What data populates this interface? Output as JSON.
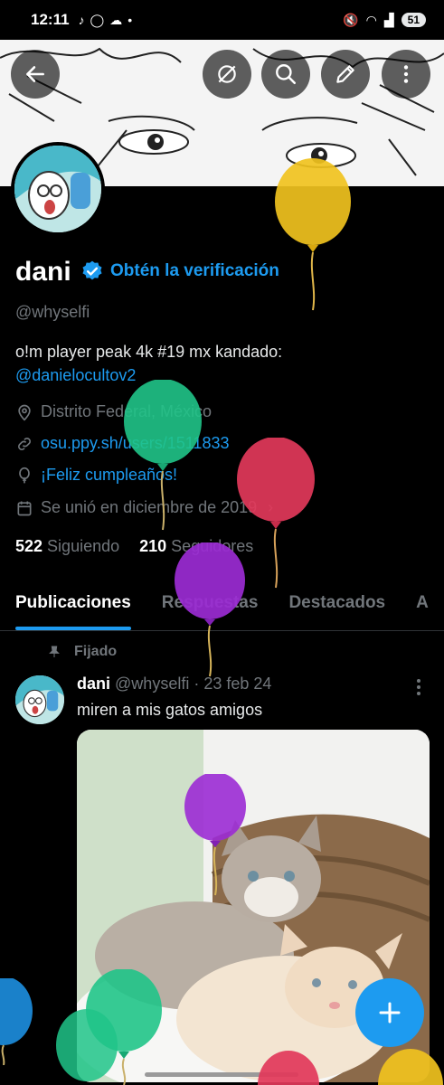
{
  "status_bar": {
    "time": "12:11",
    "battery": "51"
  },
  "profile": {
    "name": "dani",
    "get_verified": "Obtén la verificación",
    "handle": "@whyselfi",
    "bio_text": "o!m player peak 4k #19 mx   kandado:",
    "bio_link": "@danielocultov2",
    "location": "Distrito Federal, México",
    "website": "osu.ppy.sh/users/1511833",
    "birthday": "¡Feliz cumpleaños!",
    "joined": "Se unió en diciembre de 2019",
    "following_count": "522",
    "following_label": "Siguiendo",
    "followers_count": "210",
    "followers_label": "Seguidores"
  },
  "tabs": [
    "Publicaciones",
    "Respuestas",
    "Destacados",
    "A"
  ],
  "post": {
    "pinned_label": "Fijado",
    "author": "dani",
    "handle": "@whyselfi",
    "separator": "·",
    "date": "23 feb 24",
    "text": "miren a mis gatos amigos"
  },
  "colors": {
    "accent": "#1d9bf0",
    "background": "#000000",
    "muted": "#71767b"
  },
  "icons": [
    "back-arrow-icon",
    "no-notification-icon",
    "search-icon",
    "edit-icon",
    "more-vertical-icon",
    "verified-badge-icon",
    "location-icon",
    "link-icon",
    "balloon-icon",
    "calendar-icon",
    "pin-icon",
    "plus-icon"
  ]
}
